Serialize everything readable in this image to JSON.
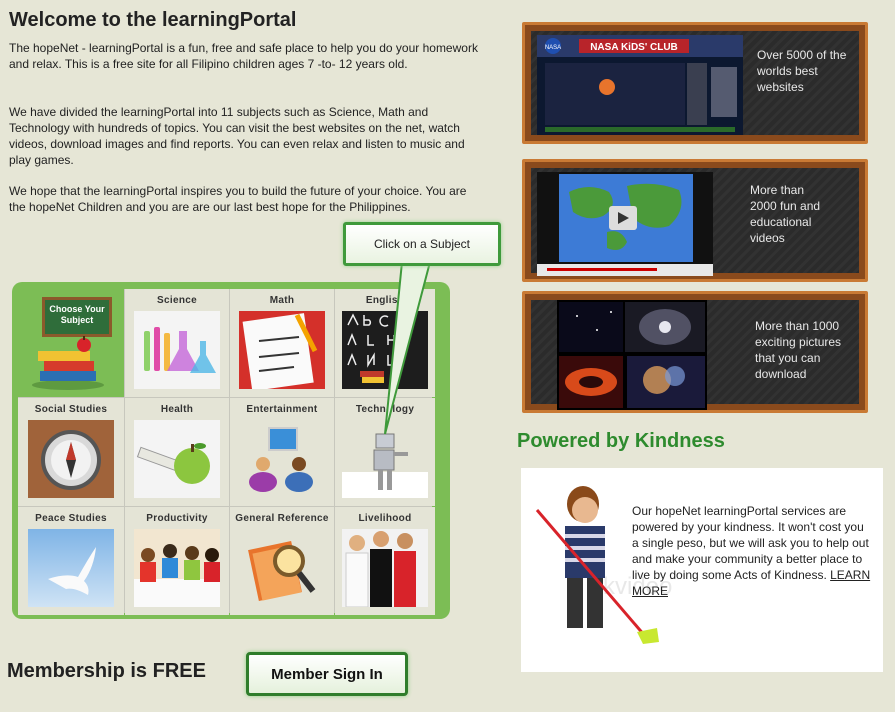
{
  "intro": {
    "title": "Welcome to the learningPortal",
    "paragraph1": "The hopeNet - learningPortal is a fun, free and safe place to help you do your homework and relax.  This is a free site for all Filipino children ages 7 -to- 12 years old.",
    "paragraph2": "We have divided the learningPortal into 11 subjects such as Science, Math and Technology with hundreds of topics.   You can visit the best websites on the net, watch videos, download images and find reports.  You can even relax and listen to music and play games.",
    "paragraph3": "We hope that the learningPortal inspires you to build the future of your choice.  You are the hopeNet Children and you are are our last best hope for the Philippines."
  },
  "callout": {
    "label": "Click on a Subject"
  },
  "choose": {
    "board_line1": "Choose Your",
    "board_line2": "Subject"
  },
  "subjects": [
    {
      "label": "Science"
    },
    {
      "label": "Math"
    },
    {
      "label": "English"
    },
    {
      "label": "Social Studies"
    },
    {
      "label": "Health"
    },
    {
      "label": "Entertainment"
    },
    {
      "label": "Technology"
    },
    {
      "label": "Peace Studies"
    },
    {
      "label": "Productivity"
    },
    {
      "label": "General Reference"
    },
    {
      "label": "Livelihood"
    }
  ],
  "boards": [
    {
      "text": "Over 5000 of the worlds best websites",
      "screenshot_title": "NASA KiDS' CLUB",
      "screenshot_logo": "NASA"
    },
    {
      "text": "More than 2000 fun and educational videos"
    },
    {
      "text": "More than 1000 exciting pictures that you can download"
    }
  ],
  "kindness": {
    "title": "Powered by Kindness",
    "text": "Our hopeNet learningPortal services are powered by your kindness.  It won't cost you a single peso, but we will ask you to help out and make your community a better place to live by doing some Acts of Kindness. ",
    "learn_more": "LEARN MORE",
    "watermark": "ckvideo"
  },
  "membership": {
    "title": "Membership is FREE",
    "signin_label": "Member Sign In"
  },
  "colors": {
    "background": "#e6e6d6",
    "accent_green": "#2e8b2e",
    "panel_green": "#7cbd55",
    "board_frame": "#c97a34"
  }
}
